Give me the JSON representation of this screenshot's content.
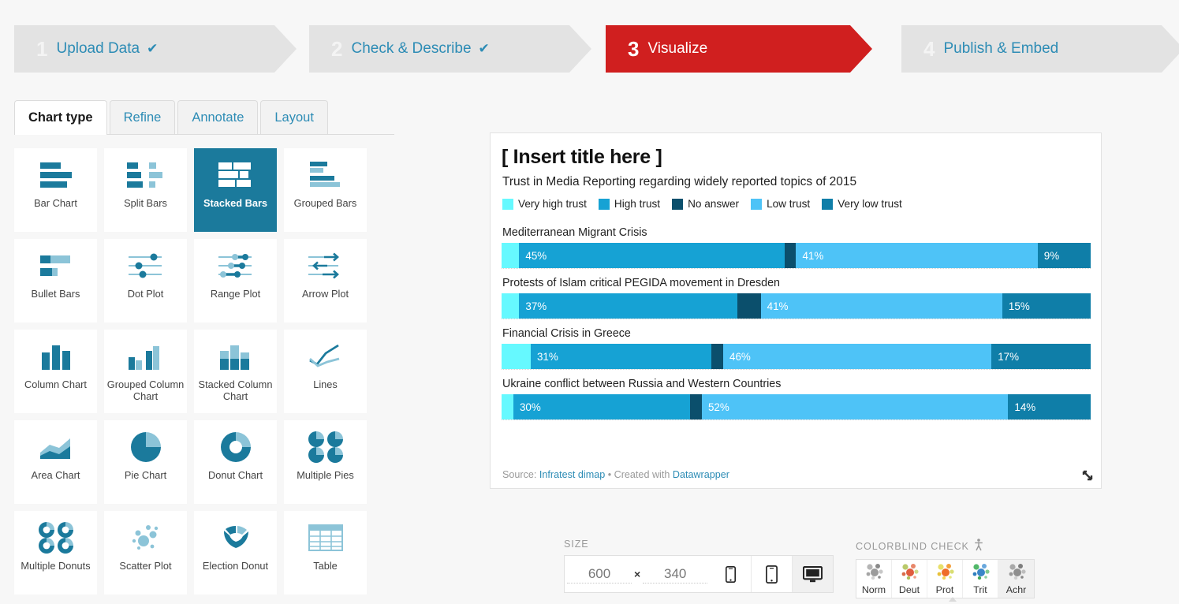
{
  "steps": [
    {
      "num": "1",
      "label": "Upload Data",
      "check": "✔",
      "state": "done"
    },
    {
      "num": "2",
      "label": "Check & Describe",
      "check": "✔",
      "state": "done"
    },
    {
      "num": "3",
      "label": "Visualize",
      "check": "",
      "state": "active"
    },
    {
      "num": "4",
      "label": "Publish & Embed",
      "check": "",
      "state": "todo"
    }
  ],
  "tabs": [
    {
      "label": "Chart type",
      "active": true
    },
    {
      "label": "Refine",
      "active": false
    },
    {
      "label": "Annotate",
      "active": false
    },
    {
      "label": "Layout",
      "active": false
    }
  ],
  "chart_types": [
    {
      "label": "Bar Chart",
      "icon": "bar-chart-icon",
      "selected": false
    },
    {
      "label": "Split Bars",
      "icon": "split-bars-icon",
      "selected": false
    },
    {
      "label": "Stacked Bars",
      "icon": "stacked-bars-icon",
      "selected": true
    },
    {
      "label": "Grouped Bars",
      "icon": "grouped-bars-icon",
      "selected": false
    },
    {
      "label": "Bullet Bars",
      "icon": "bullet-bars-icon",
      "selected": false
    },
    {
      "label": "Dot Plot",
      "icon": "dot-plot-icon",
      "selected": false
    },
    {
      "label": "Range Plot",
      "icon": "range-plot-icon",
      "selected": false
    },
    {
      "label": "Arrow Plot",
      "icon": "arrow-plot-icon",
      "selected": false
    },
    {
      "label": "Column Chart",
      "icon": "column-chart-icon",
      "selected": false
    },
    {
      "label": "Grouped Column Chart",
      "icon": "grouped-column-chart-icon",
      "selected": false
    },
    {
      "label": "Stacked Column Chart",
      "icon": "stacked-column-chart-icon",
      "selected": false
    },
    {
      "label": "Lines",
      "icon": "lines-icon",
      "selected": false
    },
    {
      "label": "Area Chart",
      "icon": "area-chart-icon",
      "selected": false
    },
    {
      "label": "Pie Chart",
      "icon": "pie-chart-icon",
      "selected": false
    },
    {
      "label": "Donut Chart",
      "icon": "donut-chart-icon",
      "selected": false
    },
    {
      "label": "Multiple Pies",
      "icon": "multiple-pies-icon",
      "selected": false
    },
    {
      "label": "Multiple Donuts",
      "icon": "multiple-donuts-icon",
      "selected": false
    },
    {
      "label": "Scatter Plot",
      "icon": "scatter-plot-icon",
      "selected": false
    },
    {
      "label": "Election Donut",
      "icon": "election-donut-icon",
      "selected": false
    },
    {
      "label": "Table",
      "icon": "table-icon",
      "selected": false
    }
  ],
  "preview": {
    "footer_source_prefix": "Source:",
    "footer_source_name": "Infratest dimap",
    "footer_middot": "•",
    "footer_created_with": "Created with",
    "footer_tool": "Datawrapper"
  },
  "chart_data": {
    "type": "bar",
    "subtype": "stacked-horizontal-100",
    "title": "[ Insert title here ]",
    "subtitle": "Trust in Media Reporting regarding widely reported topics of 2015",
    "xlabel": "",
    "ylabel": "",
    "grid": false,
    "legend_position": "top",
    "legend": [
      {
        "name": "Very high trust",
        "color": "#66f9ff"
      },
      {
        "name": "High trust",
        "color": "#16a2d4"
      },
      {
        "name": "No answer",
        "color": "#0b4f6c"
      },
      {
        "name": "Low trust",
        "color": "#4ec3f7"
      },
      {
        "name": "Very low trust",
        "color": "#0f7ea8"
      }
    ],
    "categories": [
      "Mediterranean Migrant Crisis",
      "Protests of Islam critical PEGIDA movement in Dresden",
      "Financial Crisis in Greece",
      "Ukraine conflict between Russia and Western Countries"
    ],
    "series": [
      {
        "name": "Very high trust",
        "color": "#66f9ff",
        "values": [
          3,
          3,
          5,
          2
        ],
        "show_label": false
      },
      {
        "name": "High trust",
        "color": "#16a2d4",
        "values": [
          45,
          37,
          31,
          30
        ],
        "labels": [
          "45%",
          "37%",
          "31%",
          "30%"
        ]
      },
      {
        "name": "No answer",
        "color": "#0b4f6c",
        "values": [
          2,
          4,
          2,
          2
        ],
        "show_label": false
      },
      {
        "name": "Low trust",
        "color": "#4ec3f7",
        "values": [
          41,
          41,
          46,
          52
        ],
        "labels": [
          "41%",
          "41%",
          "46%",
          "52%"
        ]
      },
      {
        "name": "Very low trust",
        "color": "#0f7ea8",
        "values": [
          9,
          15,
          17,
          14
        ],
        "labels": [
          "9%",
          "15%",
          "17%",
          "14%"
        ]
      }
    ]
  },
  "size": {
    "title": "SIZE",
    "width": "600",
    "height": "340",
    "separator": "×",
    "devices": [
      {
        "name": "phone",
        "selected": false
      },
      {
        "name": "tablet",
        "selected": false
      },
      {
        "name": "desktop",
        "selected": true
      }
    ]
  },
  "colorblind": {
    "title": "COLORBLIND CHECK",
    "options": [
      {
        "label": "Norm",
        "selected": false
      },
      {
        "label": "Deut",
        "selected": false
      },
      {
        "label": "Prot",
        "selected": false
      },
      {
        "label": "Trit",
        "selected": false
      },
      {
        "label": "Achr",
        "selected": true
      }
    ]
  }
}
